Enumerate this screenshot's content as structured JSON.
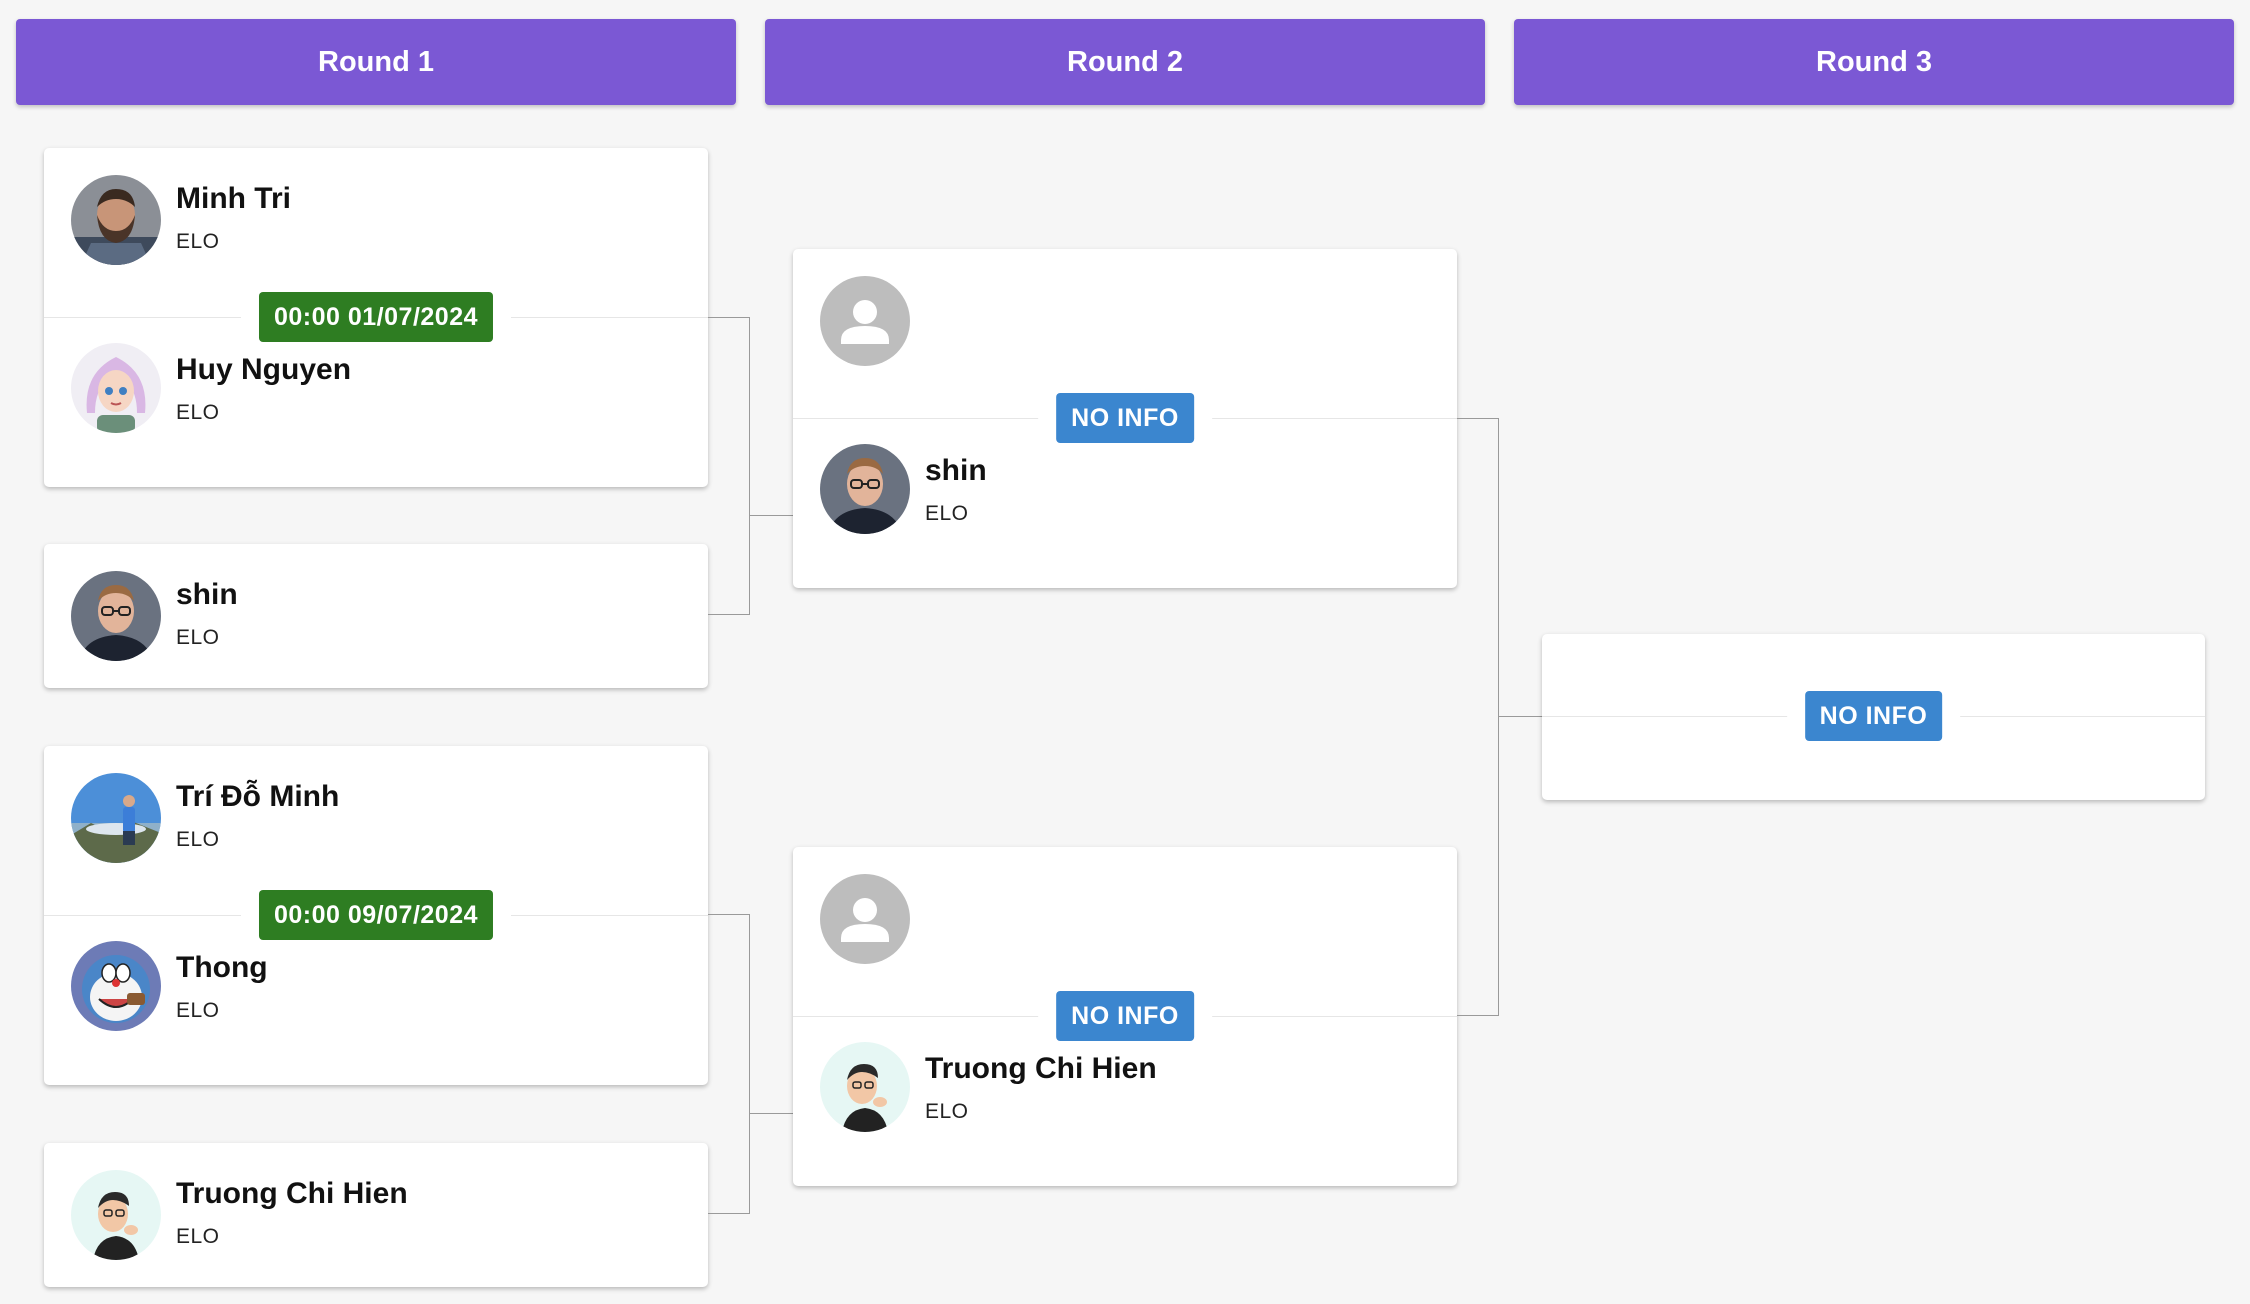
{
  "rounds": [
    {
      "label": "Round 1"
    },
    {
      "label": "Round 2"
    },
    {
      "label": "Round 3"
    }
  ],
  "elo_label": "ELO",
  "round1": {
    "match1": {
      "player1": {
        "name": "Minh Tri",
        "elo": "ELO"
      },
      "player2": {
        "name": "Huy Nguyen",
        "elo": "ELO"
      },
      "schedule": "00:00 01/07/2024"
    },
    "bye1": {
      "player": {
        "name": "shin",
        "elo": "ELO"
      }
    },
    "match2": {
      "player1": {
        "name": "Trí Đỗ Minh",
        "elo": "ELO"
      },
      "player2": {
        "name": "Thong",
        "elo": "ELO"
      },
      "schedule": "00:00 09/07/2024"
    },
    "bye2": {
      "player": {
        "name": "Truong Chi Hien",
        "elo": "ELO"
      }
    }
  },
  "round2": {
    "match1": {
      "status": "NO INFO",
      "player2": {
        "name": "shin",
        "elo": "ELO"
      }
    },
    "match2": {
      "status": "NO INFO",
      "player2": {
        "name": "Truong Chi Hien",
        "elo": "ELO"
      }
    }
  },
  "round3": {
    "final": {
      "status": "NO INFO"
    }
  },
  "colors": {
    "header": "#7b58d4",
    "date_badge": "#2e7d22",
    "noinfo_badge": "#3b86cf",
    "background": "#f6f6f6"
  },
  "icons": {
    "placeholder_avatar": "person-placeholder-icon"
  }
}
